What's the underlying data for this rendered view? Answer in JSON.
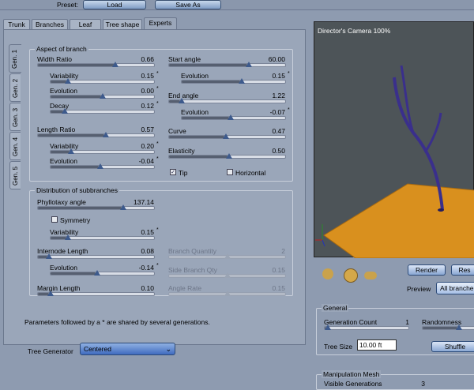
{
  "top": {
    "preset_label": "Preset:",
    "load_label": "Load",
    "save_as_label": "Save As"
  },
  "tabs": [
    "Trunk",
    "Branches",
    "Leaf",
    "Tree shape",
    "Experts"
  ],
  "gen_tabs": [
    "Gen. 1",
    "Gen. 2",
    "Gen. 3",
    "Gen. 4",
    "Gen. 5"
  ],
  "aspect": {
    "title": "Aspect of branch",
    "width_ratio": {
      "label": "Width Ratio",
      "value": "0.66"
    },
    "wr_variability": {
      "label": "Variability",
      "value": "0.15"
    },
    "wr_evolution": {
      "label": "Evolution",
      "value": "0.00"
    },
    "decay": {
      "label": "Decay",
      "value": "0.12"
    },
    "length_ratio": {
      "label": "Length Ratio",
      "value": "0.57"
    },
    "lr_variability": {
      "label": "Variability",
      "value": "0.20"
    },
    "lr_evolution": {
      "label": "Evolution",
      "value": "-0.04"
    },
    "start_angle": {
      "label": "Start angle",
      "value": "60.00"
    },
    "sa_evolution": {
      "label": "Evolution",
      "value": "0.15"
    },
    "end_angle": {
      "label": "End angle",
      "value": "1.22"
    },
    "ea_evolution": {
      "label": "Evolution",
      "value": "-0.07"
    },
    "curve": {
      "label": "Curve",
      "value": "0.47"
    },
    "elasticity": {
      "label": "Elasticity",
      "value": "0.50"
    },
    "tip": {
      "label": "Tip",
      "checked": true
    },
    "horizontal": {
      "label": "Horizontal",
      "checked": false
    }
  },
  "distribution": {
    "title": "Distribution of subbranches",
    "phyllotaxy": {
      "label": "Phyllotaxy angle",
      "value": "137.14"
    },
    "symmetry": {
      "label": "Symmetry",
      "checked": false
    },
    "variability": {
      "label": "Variability",
      "value": "0.15"
    },
    "internode": {
      "label": "Internode Length",
      "value": "0.08"
    },
    "in_evolution": {
      "label": "Evolution",
      "value": "-0.14"
    },
    "margin": {
      "label": "Margin Length",
      "value": "0.10"
    },
    "branch_qty": {
      "label": "Branch Quantity",
      "value": "2"
    },
    "side_qty": {
      "label": "Side Branch Qty",
      "value": "0.15"
    },
    "angle_rate": {
      "label": "Angle Rate",
      "value": "0.15"
    }
  },
  "star": "*",
  "footnote": "Parameters followed by a * are shared by several generations.",
  "generator": {
    "label": "Tree Generator",
    "value": "Centered"
  },
  "viewport": {
    "title": "Director's Camera 100%"
  },
  "render": {
    "render_label": "Render",
    "reset_label": "Res",
    "preview_label": "Preview",
    "preview_value": "All branche"
  },
  "general": {
    "title": "General",
    "gen_count": {
      "label": "Generation Count",
      "value": "1"
    },
    "randomness": {
      "label": "Randomness"
    },
    "tree_size": {
      "label": "Tree Size",
      "value": "10.00 ft"
    },
    "shuffle_label": "Shuffle"
  },
  "manip": {
    "title": "Manipulation Mesh",
    "visible_gen": {
      "label": "Visible Generations",
      "value": "3"
    }
  },
  "colors": {
    "accent": "#3d5a8c",
    "tree": "#3a2f8c",
    "ground": "#d9901e"
  }
}
